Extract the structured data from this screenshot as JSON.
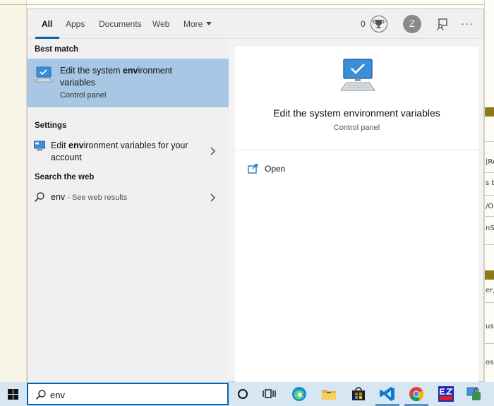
{
  "tabs": [
    {
      "label": "All"
    },
    {
      "label": "Apps"
    },
    {
      "label": "Documents"
    },
    {
      "label": "Web"
    },
    {
      "label": "More"
    }
  ],
  "header": {
    "points": "0",
    "avatar_initial": "Z",
    "icons": [
      "trophy-icon",
      "feedback-icon",
      "more-options-icon"
    ]
  },
  "results": {
    "best_match_header": "Best match",
    "best_match": {
      "title_prefix": "Edit the system ",
      "title_bold": "env",
      "title_suffix": "ironment variables",
      "subtitle": "Control panel",
      "icon": "monitor-settings-icon"
    },
    "settings_header": "Settings",
    "settings_item": {
      "title_prefix": "Edit ",
      "title_bold": "env",
      "title_suffix": "ironment variables for your account",
      "icon": "settings-monitor-icon"
    },
    "web_header": "Search the web",
    "web_item": {
      "query": "env",
      "suffix": " - See web results",
      "icon": "search-icon"
    }
  },
  "preview": {
    "title": "Edit the system environment variables",
    "subtitle": "Control panel",
    "actions": [
      {
        "label": "Open",
        "icon": "open-icon"
      }
    ]
  },
  "taskbar": {
    "search_value": "env",
    "icons": [
      "windows-start-icon",
      "cortana-icon",
      "task-view-icon",
      "edge-icon",
      "file-explorer-icon",
      "store-icon",
      "vscode-icon",
      "chrome-icon",
      "ezeds-icon",
      "security-icon"
    ]
  },
  "background": {
    "fragments": [
      "|Re",
      "s b",
      "/Or",
      "nS",
      "er,",
      "ust",
      "osi"
    ]
  },
  "colors": {
    "accent": "#0063b1",
    "selection": "#a7c7e4",
    "taskbar": "#d6e6f2"
  }
}
